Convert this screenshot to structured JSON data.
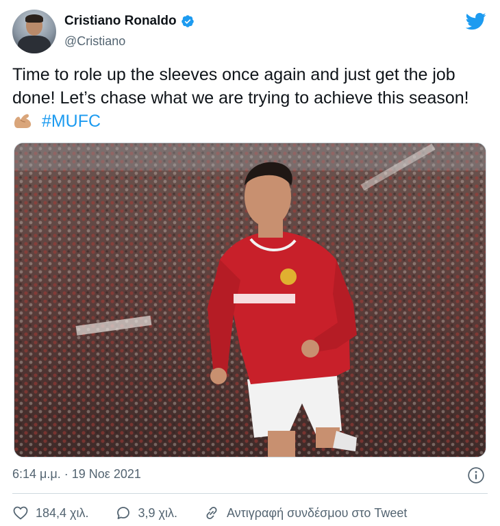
{
  "author": {
    "display_name": "Cristiano Ronaldo",
    "handle": "@Cristiano",
    "verified_icon": "verified-badge-icon",
    "avatar": "profile-photo"
  },
  "tweet": {
    "text_main": "Time to role up the sleeves once again and just get the job done! Let’s chase what we are trying to achieve this season!",
    "emoji": "flexed-biceps-emoji",
    "hashtag": "#MUFC"
  },
  "media": {
    "description_icon": "photo-player-celebrating"
  },
  "meta": {
    "timestamp": "6:14 μ.μ. · 19 Νοε 2021"
  },
  "actions": {
    "likes": "184,4 χιλ.",
    "replies": "3,9 χιλ.",
    "copy_link": "Αντιγραφή συνδέσμου στο Tweet"
  },
  "colors": {
    "accent": "#1d9bf0",
    "text": "#0f1419",
    "muted": "#536471",
    "border": "#cfd9de"
  }
}
